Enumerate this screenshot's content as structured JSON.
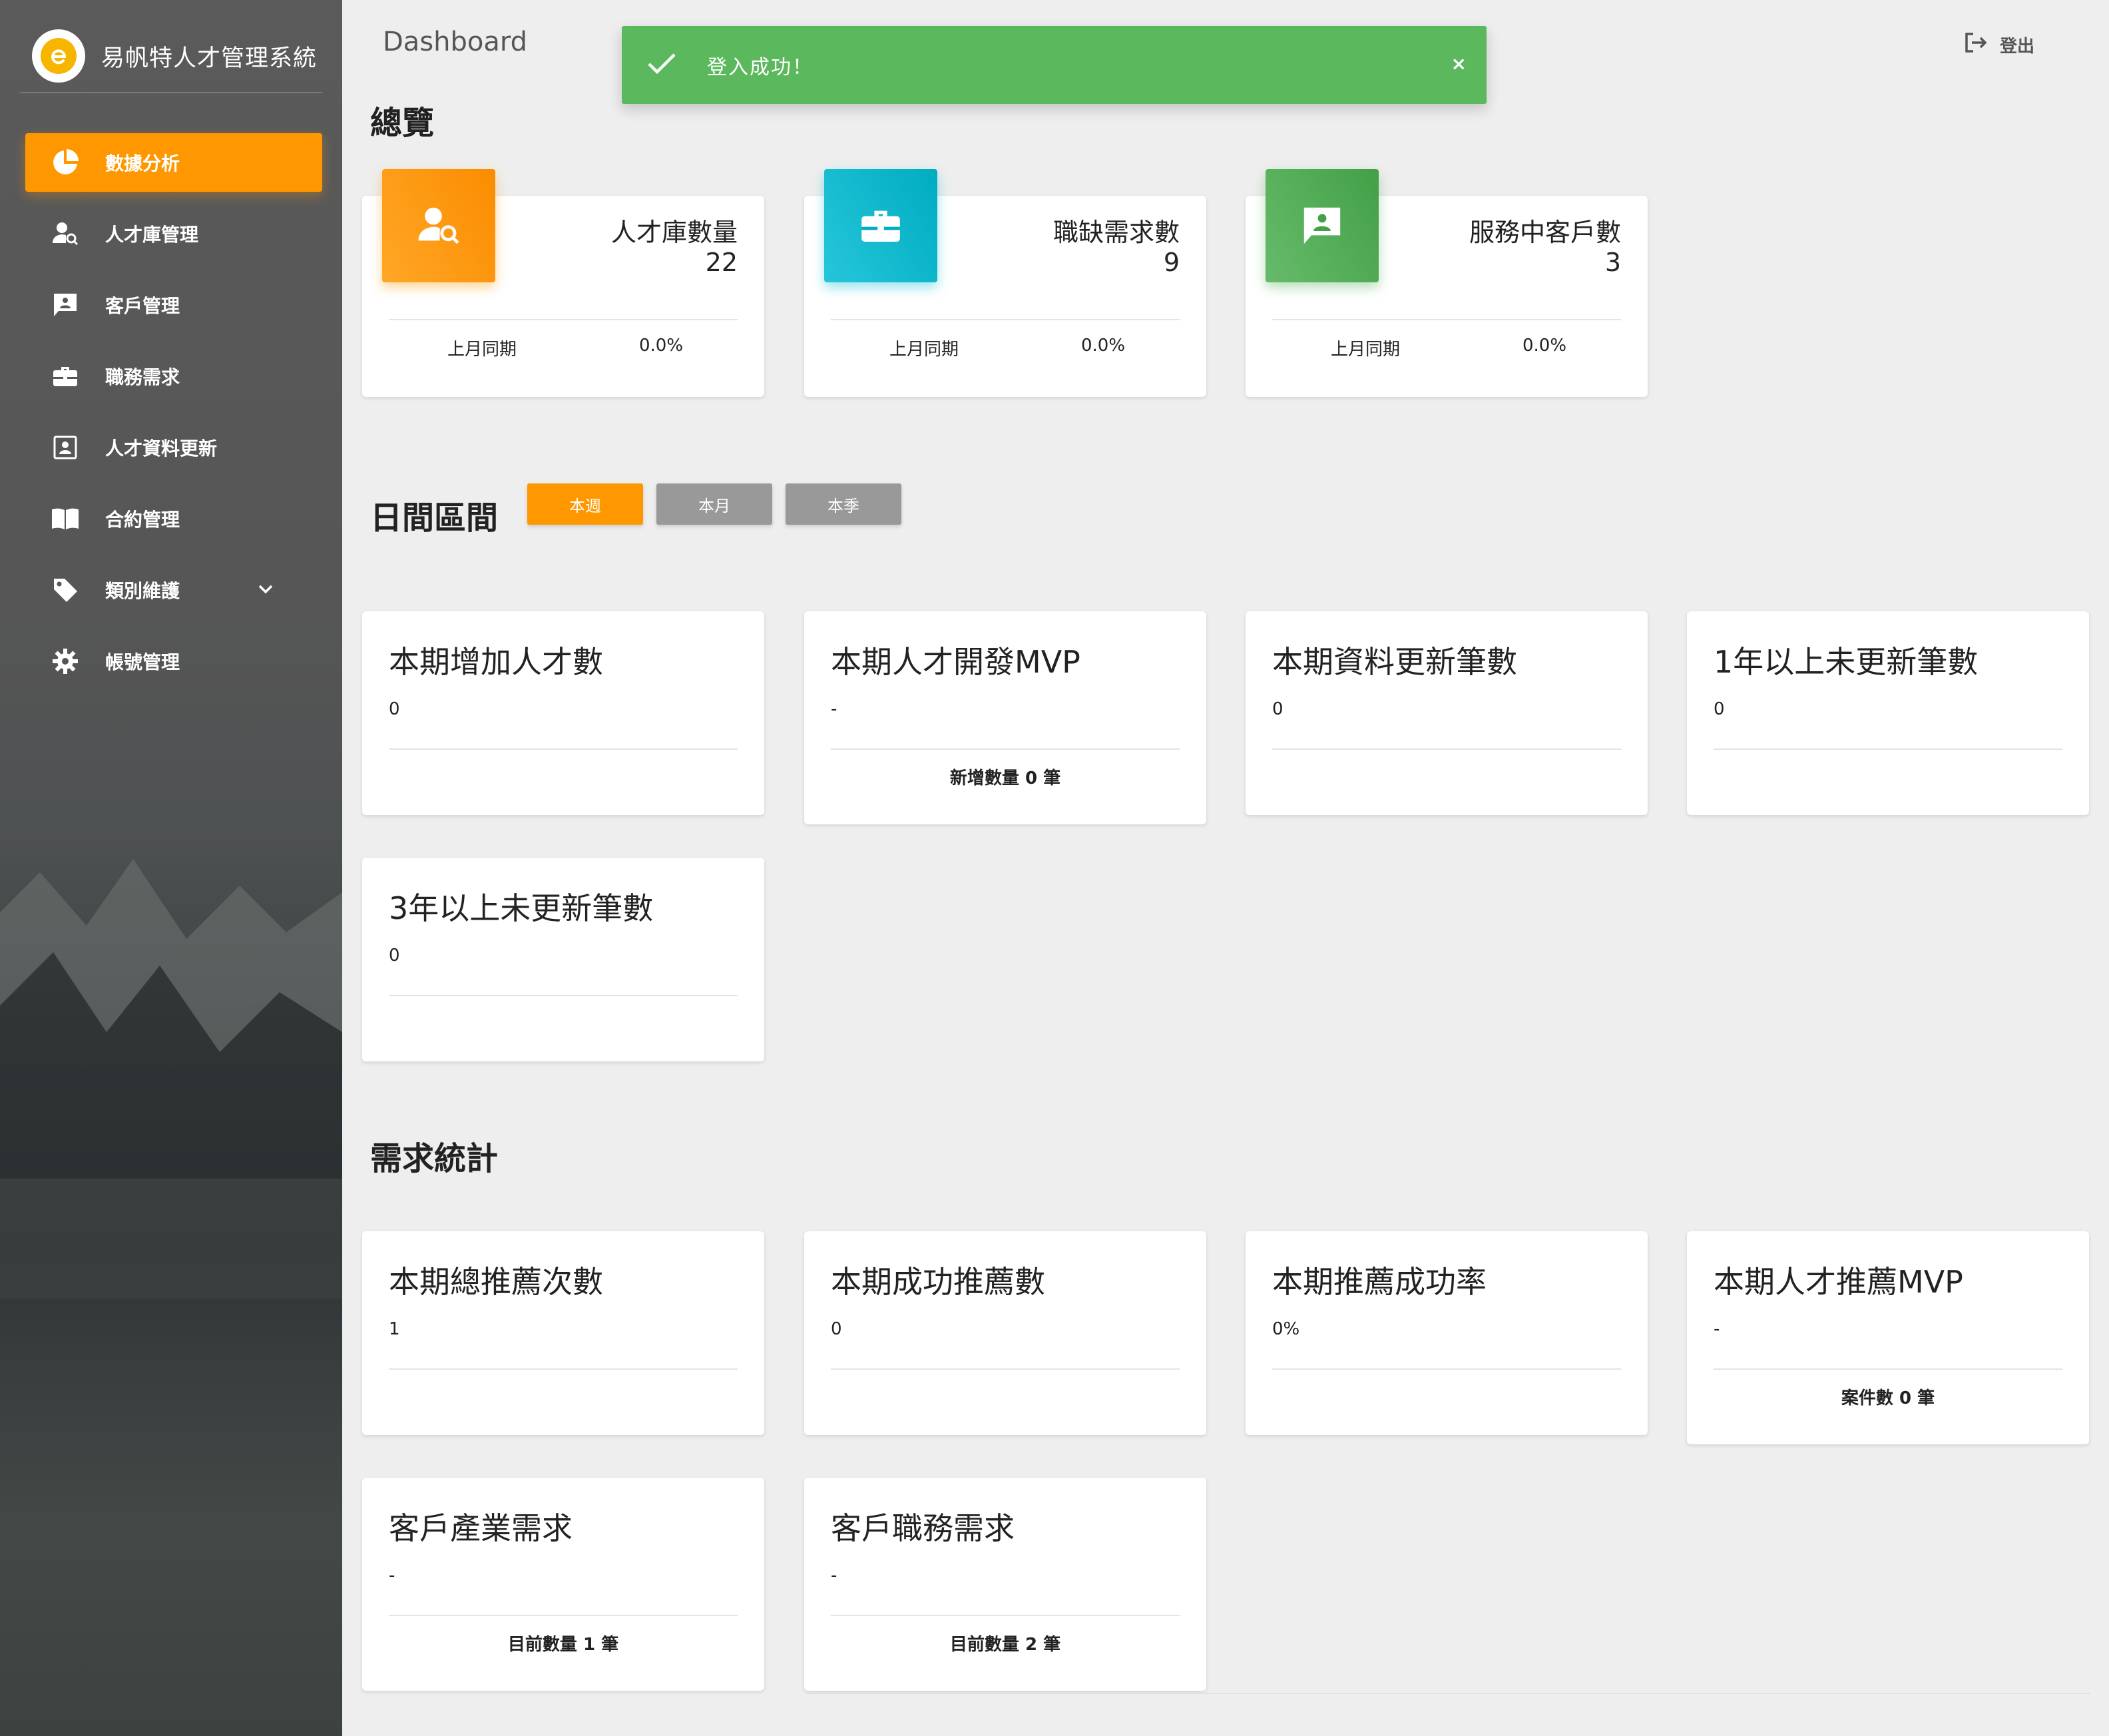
{
  "app": {
    "title": "易帆特人才管理系統"
  },
  "sidebar": {
    "items": [
      {
        "label": "數據分析",
        "icon": "pie-chart-icon",
        "active": true
      },
      {
        "label": "人才庫管理",
        "icon": "person-search-icon"
      },
      {
        "label": "客戶管理",
        "icon": "contact-card-icon"
      },
      {
        "label": "職務需求",
        "icon": "briefcase-icon"
      },
      {
        "label": "人才資料更新",
        "icon": "badge-icon"
      },
      {
        "label": "合約管理",
        "icon": "book-icon"
      },
      {
        "label": "類別維護",
        "icon": "tag-icon",
        "expandable": true
      },
      {
        "label": "帳號管理",
        "icon": "gear-icon"
      }
    ]
  },
  "header": {
    "title": "Dashboard",
    "logout_label": "登出"
  },
  "toast": {
    "message": "登入成功！",
    "close": "×"
  },
  "overview": {
    "title": "總覽",
    "cards": [
      {
        "label": "人才庫數量",
        "value": "22",
        "foot_label": "上月同期",
        "foot_value": "0.0%",
        "color": "#fb8c00"
      },
      {
        "label": "職缺需求數",
        "value": "9",
        "foot_label": "上月同期",
        "foot_value": "0.0%",
        "color": "#00acc1"
      },
      {
        "label": "服務中客戶數",
        "value": "3",
        "foot_label": "上月同期",
        "foot_value": "0.0%",
        "color": "#43a047"
      }
    ]
  },
  "range": {
    "title": "日間區間",
    "buttons": [
      {
        "label": "本週",
        "active": true
      },
      {
        "label": "本月",
        "active": false
      },
      {
        "label": "本季",
        "active": false
      }
    ]
  },
  "period_cards": [
    {
      "title": "本期增加人才數",
      "value": "0",
      "foot": ""
    },
    {
      "title": "本期人才開發MVP",
      "value": "-",
      "foot": "新增數量 0 筆"
    },
    {
      "title": "本期資料更新筆數",
      "value": "0",
      "foot": ""
    },
    {
      "title": "1年以上未更新筆數",
      "value": "0",
      "foot": ""
    },
    {
      "title": "3年以上未更新筆數",
      "value": "0",
      "foot": ""
    }
  ],
  "demand": {
    "title": "需求統計",
    "cards": [
      {
        "title": "本期總推薦次數",
        "value": "1",
        "foot": ""
      },
      {
        "title": "本期成功推薦數",
        "value": "0",
        "foot": ""
      },
      {
        "title": "本期推薦成功率",
        "value": "0%",
        "foot": ""
      },
      {
        "title": "本期人才推薦MVP",
        "value": "-",
        "foot": "案件數 0 筆"
      },
      {
        "title": "客戶產業需求",
        "value": "-",
        "foot": "目前數量 1 筆"
      },
      {
        "title": "客戶職務需求",
        "value": "-",
        "foot": "目前數量 2 筆"
      }
    ]
  }
}
